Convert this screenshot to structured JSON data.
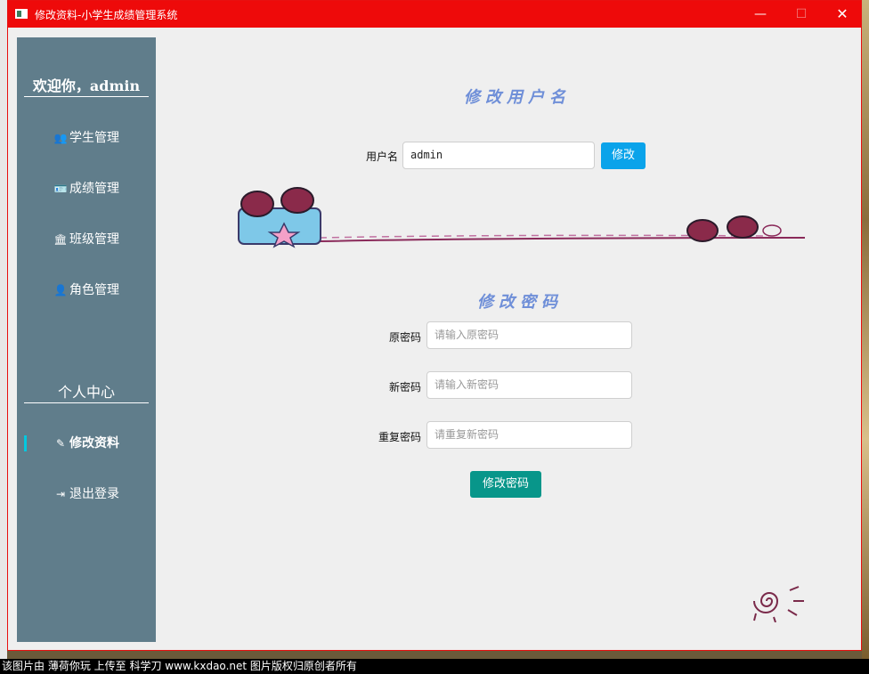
{
  "window": {
    "title": "修改资料-小学生成绩管理系统",
    "min_glyph": "—",
    "max_glyph": "☐",
    "close_glyph": "✕"
  },
  "sidebar": {
    "welcome": "欢迎你，admin",
    "items": [
      {
        "icon": "users-icon",
        "glyph": "👥",
        "label": "学生管理"
      },
      {
        "icon": "id-card-icon",
        "glyph": "🪪",
        "label": "成绩管理"
      },
      {
        "icon": "bank-icon",
        "glyph": "🏛",
        "label": "班级管理"
      },
      {
        "icon": "user-secret-icon",
        "glyph": "👤",
        "label": "角色管理"
      }
    ],
    "center_title": "个人中心",
    "center_items": [
      {
        "icon": "edit-icon",
        "glyph": "✎",
        "label": "修改资料",
        "active": true
      },
      {
        "icon": "sign-out-icon",
        "glyph": "⇥",
        "label": "退出登录",
        "active": false
      }
    ]
  },
  "username_section": {
    "title": "修改用户名",
    "label": "用户名",
    "value": "admin",
    "button": "修改"
  },
  "password_section": {
    "title": "修改密码",
    "old_label": "原密码",
    "old_placeholder": "请输入原密码",
    "new_label": "新密码",
    "new_placeholder": "请输入新密码",
    "repeat_label": "重复密码",
    "repeat_placeholder": "请重复新密码",
    "button": "修改密码"
  },
  "colors": {
    "sidebar": "#607d8b",
    "title_bar": "#ee0a0a",
    "blue_button": "#0aa3ea",
    "teal_button": "#08968a",
    "heading": "#6f8fd8"
  },
  "footer": "该图片由 薄荷你玩 上传至 科学刀 www.kxdao.net 图片版权归原创者所有"
}
